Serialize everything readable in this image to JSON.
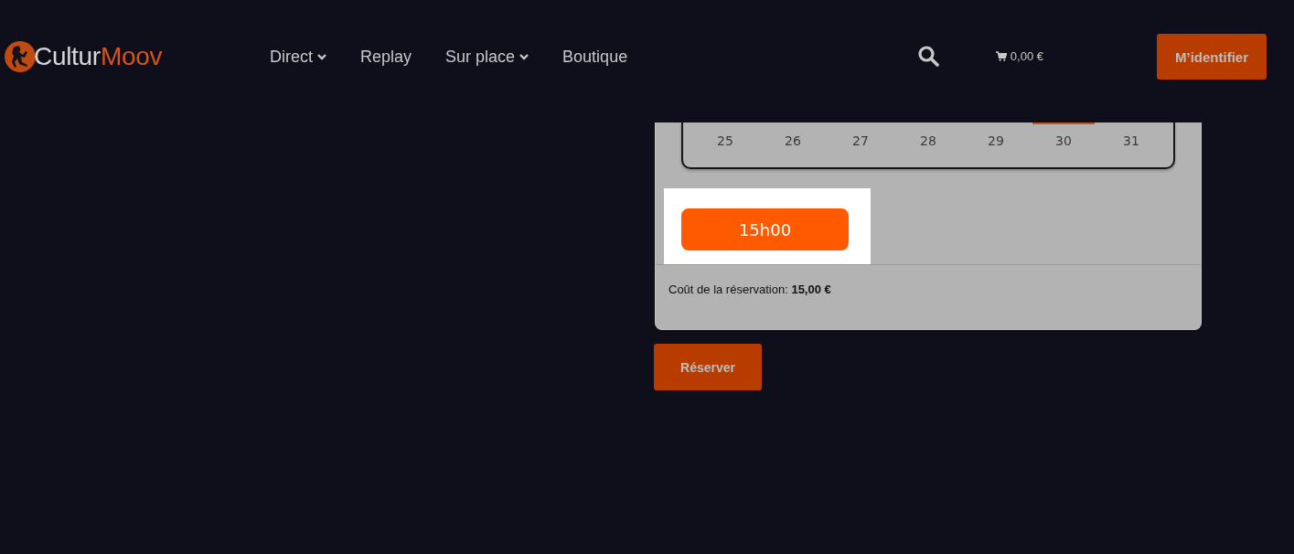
{
  "header": {
    "logo": {
      "text": "Cultur",
      "accent_text": "Moov"
    },
    "nav": [
      {
        "label": "Direct",
        "has_dropdown": true
      },
      {
        "label": "Replay",
        "has_dropdown": false
      },
      {
        "label": "Sur place",
        "has_dropdown": true
      },
      {
        "label": "Boutique",
        "has_dropdown": false
      }
    ],
    "cart": {
      "total": "0,00 €"
    },
    "login_button": "M’identifier"
  },
  "booking": {
    "calendar": {
      "days": [
        {
          "label": "25",
          "highlight_edge": false
        },
        {
          "label": "26",
          "highlight_edge": false
        },
        {
          "label": "27",
          "highlight_edge": false
        },
        {
          "label": "28",
          "highlight_edge": false
        },
        {
          "label": "29",
          "highlight_edge": false
        },
        {
          "label": "30",
          "highlight_edge": true
        },
        {
          "label": "31",
          "highlight_edge": false
        }
      ]
    },
    "time_slots": [
      {
        "label": "15h00",
        "selected": true
      }
    ],
    "cost": "Coût de la réservation: **15,00 €**",
    "submit_button": "Réserver"
  }
}
